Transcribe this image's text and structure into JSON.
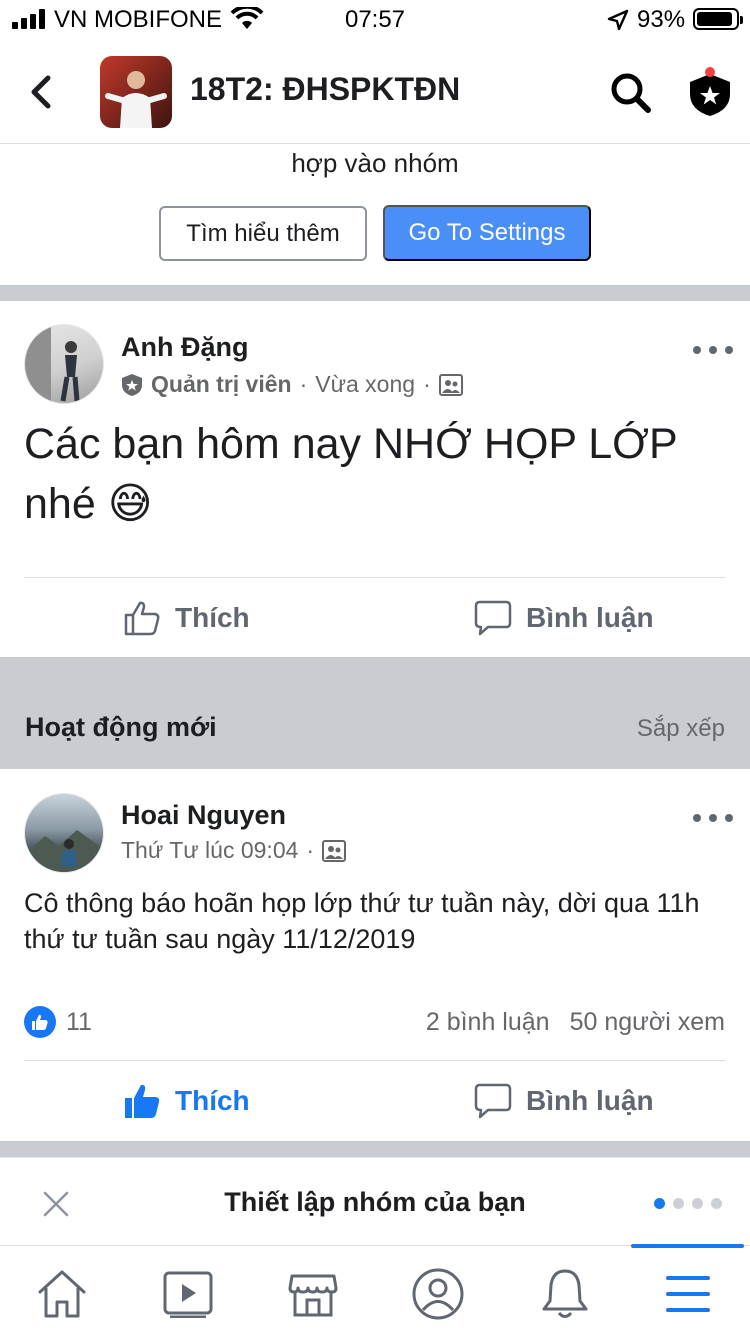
{
  "status_bar": {
    "carrier": "VN MOBIFONE",
    "time": "07:57",
    "battery": "93%",
    "battery_level": 0.93
  },
  "header": {
    "group_name": "18T2: ĐHSPKTĐN"
  },
  "banner": {
    "text": "hợp vào nhóm",
    "learn_more_label": "Tìm hiểu thêm",
    "settings_label": "Go To Settings"
  },
  "post1": {
    "author": "Anh Đặng",
    "role": "Quản trị viên",
    "time": "Vừa xong",
    "text": "Các bạn hôm nay NHỚ HỌP LỚP nhé 😅",
    "like_label": "Thích",
    "comment_label": "Bình luận"
  },
  "section": {
    "title": "Hoạt động mới",
    "sort_label": "Sắp xếp"
  },
  "post2": {
    "author": "Hoai Nguyen",
    "time": "Thứ Tư lúc 09:04",
    "text": "Cô thông báo hoãn họp lớp thứ tư tuần này, dời qua 11h thứ tư tuần sau ngày 11/12/2019",
    "like_count": "11",
    "comments_count": "2 bình luận",
    "views_count": "50 người xem",
    "like_label": "Thích",
    "comment_label": "Bình luận"
  },
  "setup_card": {
    "title": "Thiết lập nhóm của bạn",
    "active_page": 1,
    "page_count": 4
  },
  "tabbar": {
    "tabs": [
      "home-icon",
      "watch-icon",
      "marketplace-icon",
      "profile-icon",
      "notifications-icon",
      "menu-icon"
    ],
    "active": "menu-icon"
  },
  "colors": {
    "accent": "#1877f2",
    "button_blue": "#4a8ef8",
    "divider": "#c9ccd1",
    "secondary_text": "#65676b"
  }
}
